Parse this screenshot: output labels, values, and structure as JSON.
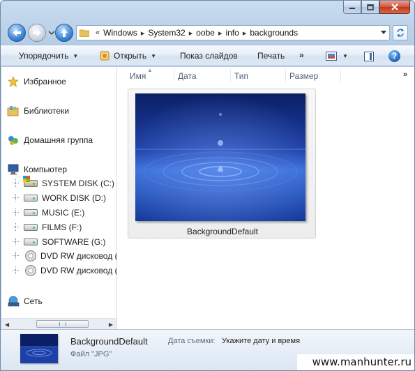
{
  "window": {
    "caption_buttons": [
      "minimize",
      "maximize",
      "close"
    ]
  },
  "address": {
    "breadcrumbs": [
      "Windows",
      "System32",
      "oobe",
      "info",
      "backgrounds"
    ],
    "overflow": "«"
  },
  "toolbar": {
    "organize": "Упорядочить",
    "open": "Открыть",
    "slideshow": "Показ слайдов",
    "print": "Печать",
    "more": "»"
  },
  "sidebar": {
    "favorites": "Избранное",
    "libraries": "Библиотеки",
    "homegroup": "Домашняя группа",
    "computer": "Компьютер",
    "drives": [
      {
        "label": "SYSTEM DISK (C:)",
        "icon": "system-drive-icon"
      },
      {
        "label": "WORK DISK (D:)",
        "icon": "hard-drive-icon"
      },
      {
        "label": "MUSIC (E:)",
        "icon": "hard-drive-icon"
      },
      {
        "label": "FILMS (F:)",
        "icon": "hard-drive-icon"
      },
      {
        "label": "SOFTWARE (G:)",
        "icon": "hard-drive-icon"
      },
      {
        "label": "DVD RW дисковод (H",
        "icon": "dvd-drive-icon"
      },
      {
        "label": "DVD RW дисковод (I:)",
        "icon": "dvd-drive-icon"
      }
    ],
    "network": "Сеть"
  },
  "columns": [
    "Имя",
    "Дата",
    "Тип",
    "Размер"
  ],
  "files": [
    {
      "name": "BackgroundDefault"
    }
  ],
  "details": {
    "name": "BackgroundDefault",
    "type": "Файл \"JPG\"",
    "date_label": "Дата съемки:",
    "date_value": "Укажите дату и время"
  },
  "watermark": "www.manhunter.ru",
  "colors": {
    "accent": "#2a6fc4",
    "water_dark": "#0b1f66",
    "water_light": "#3a6fd8"
  }
}
